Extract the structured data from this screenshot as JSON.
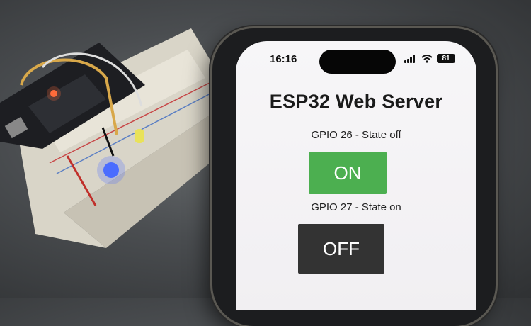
{
  "status_bar": {
    "time": "16:16",
    "battery": "81",
    "icons": [
      "signal-icon",
      "wifi-icon",
      "battery-icon"
    ]
  },
  "page": {
    "title": "ESP32 Web Server",
    "gpio26": {
      "label": "GPIO 26 - State off",
      "button": "ON",
      "color": "#4caf50"
    },
    "gpio27": {
      "label": "GPIO 27 - State on",
      "button": "OFF",
      "color": "#333333"
    }
  }
}
